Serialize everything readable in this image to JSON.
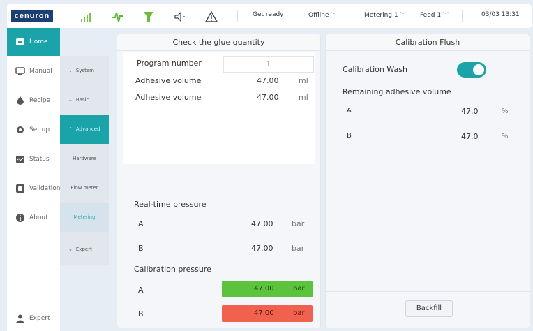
{
  "topbar": {
    "logo": "cenuron",
    "status_text": "Get ready",
    "connection": "Offline",
    "metering": "Metering 1",
    "feed": "Feed 1",
    "datetime": "03/03 13:31",
    "icons": [
      "signal-icon",
      "pulse-icon",
      "funnel-icon",
      "speaker-icon",
      "warning-icon"
    ]
  },
  "nav": {
    "items": [
      {
        "label": "Home",
        "icon": "home-icon",
        "active": true
      },
      {
        "label": "Manual",
        "icon": "monitor-icon"
      },
      {
        "label": "Recipe",
        "icon": "drop-icon"
      },
      {
        "label": "Set up",
        "icon": "gear-icon"
      },
      {
        "label": "Status",
        "icon": "status-icon"
      },
      {
        "label": "Validation",
        "icon": "validation-icon"
      },
      {
        "label": "About",
        "icon": "info-icon"
      }
    ],
    "user": "Expert"
  },
  "subnav": {
    "system": "System",
    "basic": "Basic",
    "advanced": "Advanced",
    "hardware": "Hardware",
    "flowmeter": "Flow meter",
    "metering": "Metering",
    "expert": "Expert"
  },
  "glue_panel": {
    "title": "Check the glue quantity",
    "program_label": "Program number",
    "program_value": "1",
    "adhesive_rows": [
      {
        "label": "Adhesive volume",
        "value": "47.00",
        "unit": "ml"
      },
      {
        "label": "Adhesive volume",
        "value": "47.00",
        "unit": "ml"
      }
    ],
    "realtime_title": "Real-time pressure",
    "realtime_rows": [
      {
        "label": "A",
        "value": "47.00",
        "unit": "bar"
      },
      {
        "label": "B",
        "value": "47.00",
        "unit": "bar"
      }
    ],
    "calib_title": "Calibration pressure",
    "calib_rows": [
      {
        "label": "A",
        "value": "47.00",
        "unit": "bar",
        "status_color": "#5cc43c"
      },
      {
        "label": "B",
        "value": "47.00",
        "unit": "bar",
        "status_color": "#f0624f"
      }
    ]
  },
  "flush_panel": {
    "title": "Calibration Flush",
    "wash_label": "Calibration Wash",
    "wash_on": true,
    "remaining_title": "Remaining adhesive volume",
    "remaining_rows": [
      {
        "label": "A",
        "value": "47.0",
        "unit": "%"
      },
      {
        "label": "B",
        "value": "47.0",
        "unit": "%"
      }
    ],
    "backfill_label": "Backfill"
  },
  "colors": {
    "accent": "#1aa3a8",
    "ok": "#5cc43c",
    "alarm": "#f0624f",
    "brand": "#1b3f73"
  }
}
